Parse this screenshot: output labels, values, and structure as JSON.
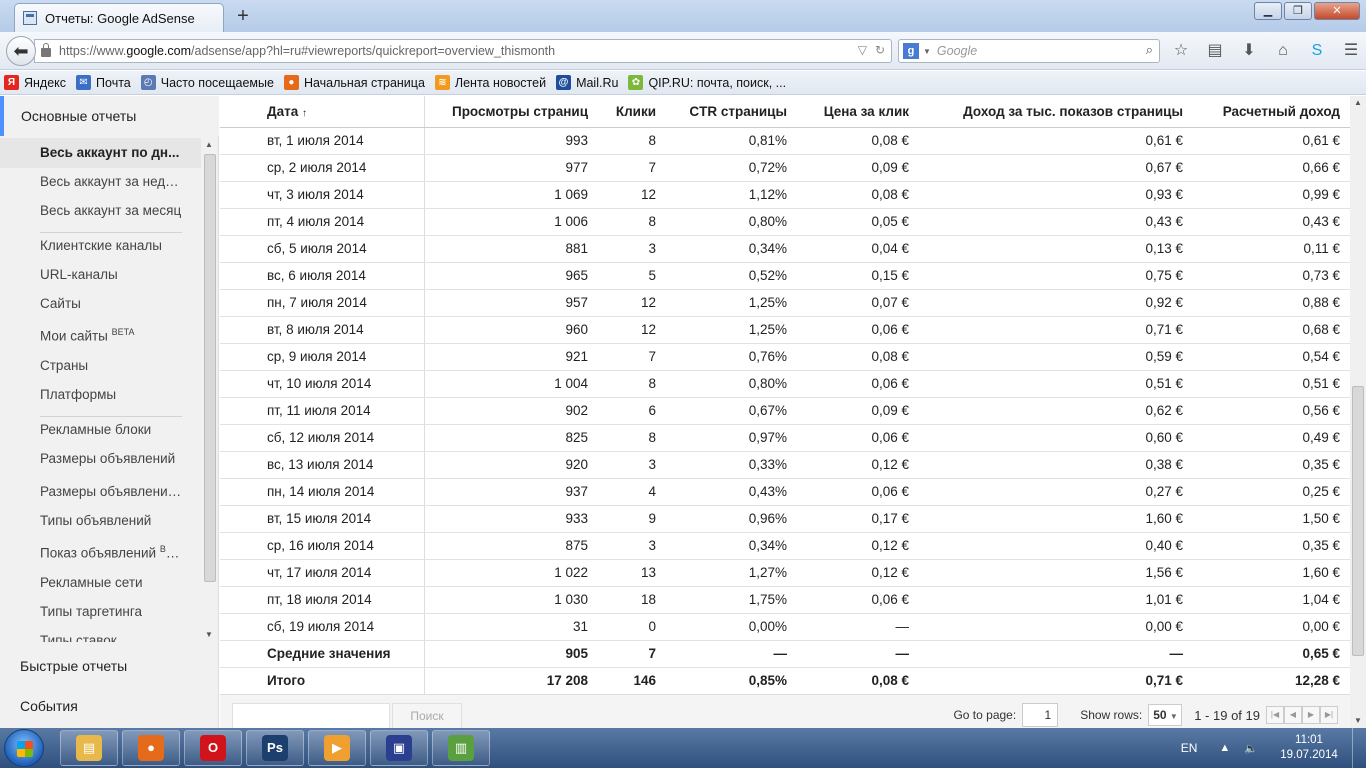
{
  "browser": {
    "tab_title": "Отчеты: Google AdSense",
    "new_tab_label": "+",
    "url_prefix": "https://www.",
    "url_domain": "google.com",
    "url_path": "/adsense/app?hl=ru#viewreports/quickreport=overview_thismonth",
    "search_placeholder": "Google",
    "search_engine_badge": "g"
  },
  "bookmarks": [
    {
      "label": "Яндекс",
      "icon": "yandex-icon",
      "color": "#e52620",
      "glyph": "Я"
    },
    {
      "label": "Почта",
      "icon": "mail-icon",
      "color": "#3a6fc4",
      "glyph": "✉"
    },
    {
      "label": "Часто посещаемые",
      "icon": "frequent-icon",
      "color": "#5b7ab5",
      "glyph": "◴"
    },
    {
      "label": "Начальная страница",
      "icon": "firefox-icon",
      "color": "#e56a1a",
      "glyph": "●"
    },
    {
      "label": "Лента новостей",
      "icon": "rss-icon",
      "color": "#f29a1f",
      "glyph": "≋"
    },
    {
      "label": "Mail.Ru",
      "icon": "mailru-icon",
      "color": "#1e4f9c",
      "glyph": "@"
    },
    {
      "label": "QIP.RU: почта, поиск, ...",
      "icon": "qip-icon",
      "color": "#7cb83a",
      "glyph": "✿"
    }
  ],
  "sidebar": {
    "top_section": "Основные отчеты",
    "items": [
      {
        "label": "Весь аккаунт по дн...",
        "current": true
      },
      {
        "label": "Весь аккаунт за неде..."
      },
      {
        "label": "Весь аккаунт за месяц"
      },
      {
        "label": "Клиентские каналы"
      },
      {
        "label": "URL-каналы"
      },
      {
        "label": "Сайты"
      },
      {
        "label": "Мои сайты",
        "badge": "BETA"
      },
      {
        "label": "Страны"
      },
      {
        "label": "Платформы"
      },
      {
        "label": "Рекламные блоки"
      },
      {
        "label": "Размеры объявлений"
      },
      {
        "label": "Размеры объявлений..."
      },
      {
        "label": "Типы объявлений"
      },
      {
        "label": "Показ объявлений",
        "badge": "BETA"
      },
      {
        "label": "Рекламные сети"
      },
      {
        "label": "Типы таргетинга"
      },
      {
        "label": "Типы ставок"
      }
    ],
    "bottom_sections": [
      "Быстрые отчеты",
      "События"
    ]
  },
  "report": {
    "columns": [
      "Дата",
      "Просмотры страниц",
      "Клики",
      "CTR страницы",
      "Цена за клик",
      "Доход за тыс. показов страницы",
      "Расчетный доход"
    ],
    "sort_arrow": "↑",
    "rows": [
      [
        "вт, 1 июля 2014",
        "993",
        "8",
        "0,81%",
        "0,08 €",
        "0,61 €",
        "0,61 €"
      ],
      [
        "ср, 2 июля 2014",
        "977",
        "7",
        "0,72%",
        "0,09 €",
        "0,67 €",
        "0,66 €"
      ],
      [
        "чт, 3 июля 2014",
        "1 069",
        "12",
        "1,12%",
        "0,08 €",
        "0,93 €",
        "0,99 €"
      ],
      [
        "пт, 4 июля 2014",
        "1 006",
        "8",
        "0,80%",
        "0,05 €",
        "0,43 €",
        "0,43 €"
      ],
      [
        "сб, 5 июля 2014",
        "881",
        "3",
        "0,34%",
        "0,04 €",
        "0,13 €",
        "0,11 €"
      ],
      [
        "вс, 6 июля 2014",
        "965",
        "5",
        "0,52%",
        "0,15 €",
        "0,75 €",
        "0,73 €"
      ],
      [
        "пн, 7 июля 2014",
        "957",
        "12",
        "1,25%",
        "0,07 €",
        "0,92 €",
        "0,88 €"
      ],
      [
        "вт, 8 июля 2014",
        "960",
        "12",
        "1,25%",
        "0,06 €",
        "0,71 €",
        "0,68 €"
      ],
      [
        "ср, 9 июля 2014",
        "921",
        "7",
        "0,76%",
        "0,08 €",
        "0,59 €",
        "0,54 €"
      ],
      [
        "чт, 10 июля 2014",
        "1 004",
        "8",
        "0,80%",
        "0,06 €",
        "0,51 €",
        "0,51 €"
      ],
      [
        "пт, 11 июля 2014",
        "902",
        "6",
        "0,67%",
        "0,09 €",
        "0,62 €",
        "0,56 €"
      ],
      [
        "сб, 12 июля 2014",
        "825",
        "8",
        "0,97%",
        "0,06 €",
        "0,60 €",
        "0,49 €"
      ],
      [
        "вс, 13 июля 2014",
        "920",
        "3",
        "0,33%",
        "0,12 €",
        "0,38 €",
        "0,35 €"
      ],
      [
        "пн, 14 июля 2014",
        "937",
        "4",
        "0,43%",
        "0,06 €",
        "0,27 €",
        "0,25 €"
      ],
      [
        "вт, 15 июля 2014",
        "933",
        "9",
        "0,96%",
        "0,17 €",
        "1,60 €",
        "1,50 €"
      ],
      [
        "ср, 16 июля 2014",
        "875",
        "3",
        "0,34%",
        "0,12 €",
        "0,40 €",
        "0,35 €"
      ],
      [
        "чт, 17 июля 2014",
        "1 022",
        "13",
        "1,27%",
        "0,12 €",
        "1,56 €",
        "1,60 €"
      ],
      [
        "пт, 18 июля 2014",
        "1 030",
        "18",
        "1,75%",
        "0,06 €",
        "1,01 €",
        "1,04 €"
      ],
      [
        "сб, 19 июля 2014",
        "31",
        "0",
        "0,00%",
        "—",
        "0,00 €",
        "0,00 €"
      ]
    ],
    "summary_rows": [
      [
        "Средние значения",
        "905",
        "7",
        "—",
        "—",
        "—",
        "0,65 €"
      ],
      [
        "Итого",
        "17 208",
        "146",
        "0,85%",
        "0,08 €",
        "0,71 €",
        "12,28 €"
      ]
    ]
  },
  "footer": {
    "filter_button": "Поиск",
    "go_to_page_label": "Go to page:",
    "page_value": "1",
    "show_rows_label": "Show rows:",
    "rows_value": "50",
    "count_text": "1 - 19 of 19"
  },
  "taskbar": {
    "apps": [
      {
        "name": "explorer-icon",
        "color": "#e8b84a",
        "glyph": "▤"
      },
      {
        "name": "firefox-icon",
        "color": "#e56a1a",
        "glyph": "●"
      },
      {
        "name": "opera-icon",
        "color": "#d1141b",
        "glyph": "O"
      },
      {
        "name": "photoshop-icon",
        "color": "#1c3f6e",
        "glyph": "Ps"
      },
      {
        "name": "media-player-icon",
        "color": "#f0a030",
        "glyph": "▶"
      },
      {
        "name": "save-disk-icon",
        "color": "#2a3f8f",
        "glyph": "▣"
      },
      {
        "name": "app-icon",
        "color": "#5aa040",
        "glyph": "▥"
      }
    ],
    "lang": "EN",
    "time": "11:01",
    "date": "19.07.2014"
  }
}
